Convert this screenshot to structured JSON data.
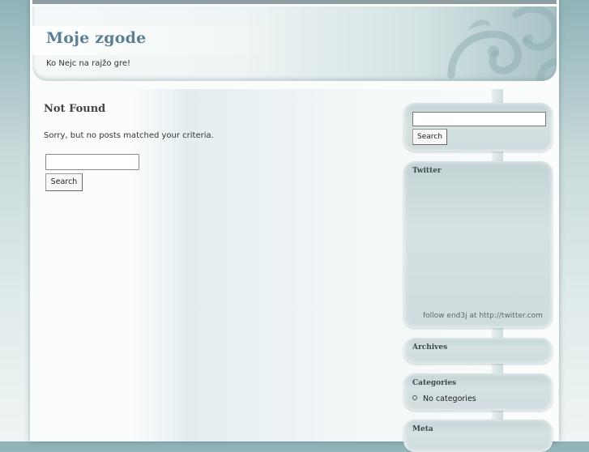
{
  "site": {
    "title": "Moje zgode",
    "description": "Ko Nejc na rajžo gre!"
  },
  "main": {
    "heading": "Not Found",
    "message": "Sorry, but no posts matched your criteria.",
    "search_value": "",
    "search_button": "Search"
  },
  "sidebar": {
    "search": {
      "value": "",
      "button": "Search"
    },
    "twitter": {
      "title": "Twitter",
      "follow_text": "follow end3j at http://twitter.com"
    },
    "archives": {
      "title": "Archives"
    },
    "categories": {
      "title": "Categories",
      "items": [
        "No categories"
      ]
    },
    "meta": {
      "title": "Meta"
    }
  },
  "colors": {
    "title": "#5a7f92",
    "page_bg": "#fbfdfd",
    "sidebar_box": "#cfdcdd"
  }
}
